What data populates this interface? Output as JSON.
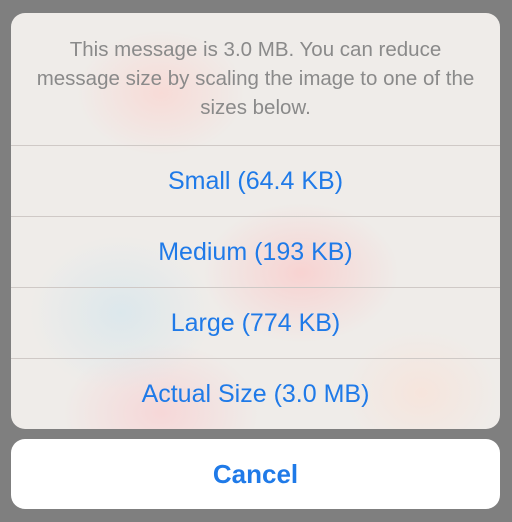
{
  "action_sheet": {
    "message": "This message is 3.0 MB. You can reduce message size by scaling the image to one of the sizes below.",
    "options": [
      {
        "label": "Small (64.4 KB)"
      },
      {
        "label": "Medium (193 KB)"
      },
      {
        "label": "Large (774 KB)"
      },
      {
        "label": "Actual Size (3.0 MB)"
      }
    ],
    "cancel_label": "Cancel"
  },
  "colors": {
    "accent": "#1f7ae8",
    "message_text": "#8a8a8a",
    "dim_backdrop": "#7f7f7f",
    "sheet_background": "#efece9",
    "separator": "#cfc9c6"
  }
}
